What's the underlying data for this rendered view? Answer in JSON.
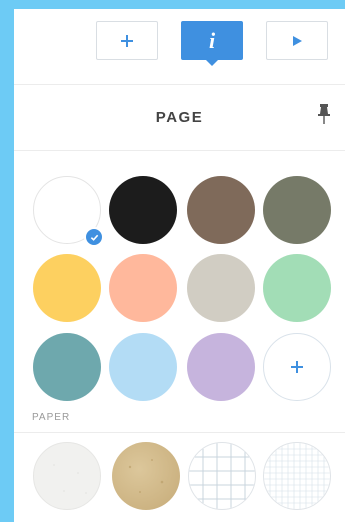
{
  "toolbar": {
    "buttons": [
      {
        "name": "add",
        "icon": "plus-icon",
        "active": false
      },
      {
        "name": "info",
        "icon": "info-icon",
        "label": "i",
        "active": true
      },
      {
        "name": "play",
        "icon": "play-icon",
        "active": false
      }
    ],
    "accent": "#3f90e0"
  },
  "page": {
    "title": "PAGE",
    "pin_icon": "pin-icon"
  },
  "colors": {
    "selected": "#ffffff",
    "swatches": [
      "#ffffff",
      "#1c1c1c",
      "#7f6a5a",
      "#767a68",
      "#fdd060",
      "#ffb89c",
      "#d1cdc3",
      "#a2ddb6",
      "#6ea8ad",
      "#b3dcf5",
      "#c6b4dd"
    ],
    "add_icon": "plus-icon"
  },
  "paper": {
    "label": "PAPER",
    "textures": [
      "plain-paper",
      "kraft-paper",
      "grid-paper",
      "fine-grid-paper"
    ]
  }
}
